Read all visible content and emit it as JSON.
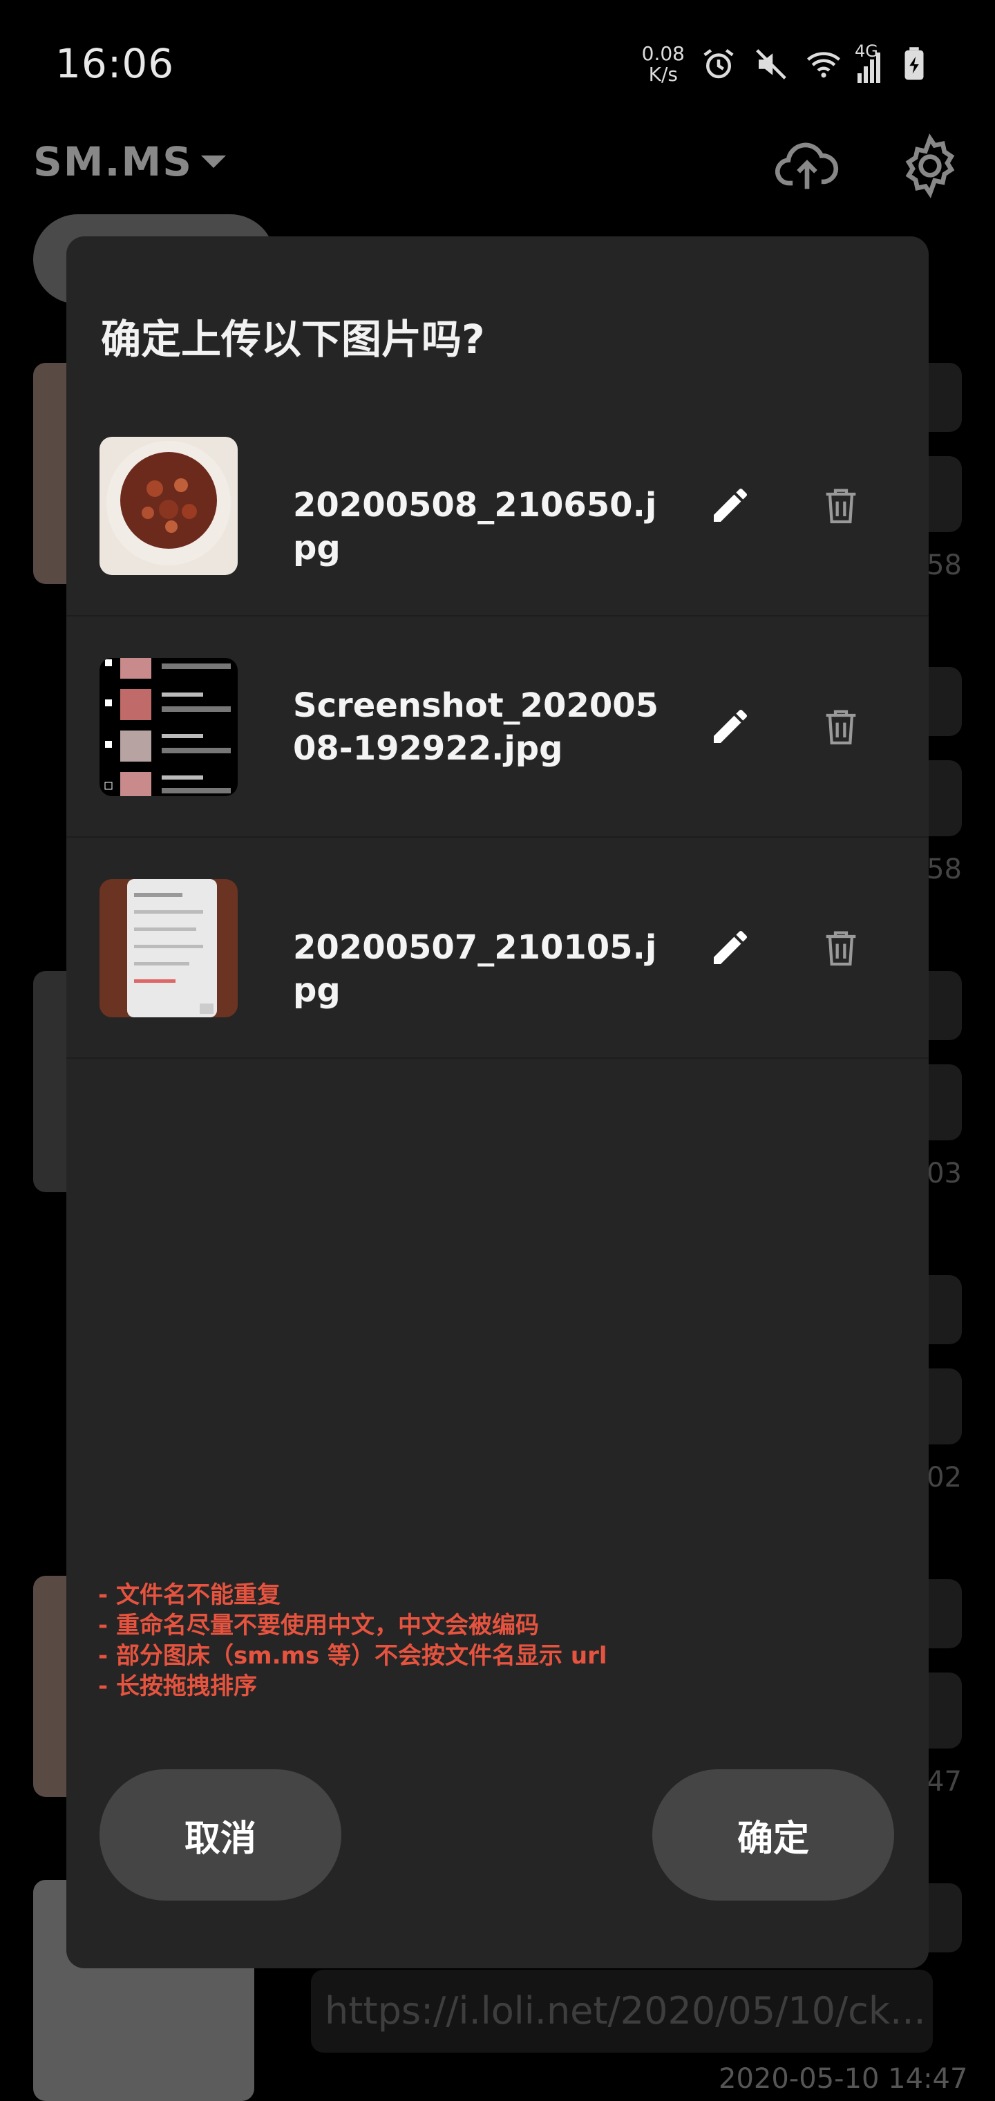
{
  "status_bar": {
    "time": "16:06",
    "net_speed_value": "0.08",
    "net_speed_unit": "K/s",
    "network_type": "4G",
    "icons": [
      "alarm-icon",
      "mute-icon",
      "wifi-icon",
      "cellular-signal-icon",
      "battery-charging-icon"
    ]
  },
  "app_bar": {
    "title": "SM.MS",
    "actions": [
      "cloud-upload-icon",
      "gear-icon"
    ]
  },
  "background": {
    "url_text": "https://i.loli.net/2020/05/10/ck...",
    "date_text": "2020-05-10 14:47",
    "side_texts": [
      "58",
      "58",
      "03",
      "02",
      "47"
    ]
  },
  "dialog": {
    "title": "确定上传以下图片吗?",
    "files": [
      {
        "name": "20200508_210650.jpg",
        "thumb": "food-bowl-thumbnail"
      },
      {
        "name": "Screenshot_20200508-192922.jpg",
        "thumb": "screenshot-list-thumbnail"
      },
      {
        "name": "20200507_210105.jpg",
        "thumb": "phone-photo-thumbnail"
      }
    ],
    "tips": [
      "- 文件名不能重复",
      "- 重命名尽量不要使用中文，中文会被编码",
      "- 部分图床（sm.ms 等）不会按文件名显示 url",
      "- 长按拖拽排序"
    ],
    "cancel_label": "取消",
    "confirm_label": "确定"
  },
  "colors": {
    "dialog_bg": "#252525",
    "tip_text": "#e6533f",
    "button_bg": "#454545"
  }
}
